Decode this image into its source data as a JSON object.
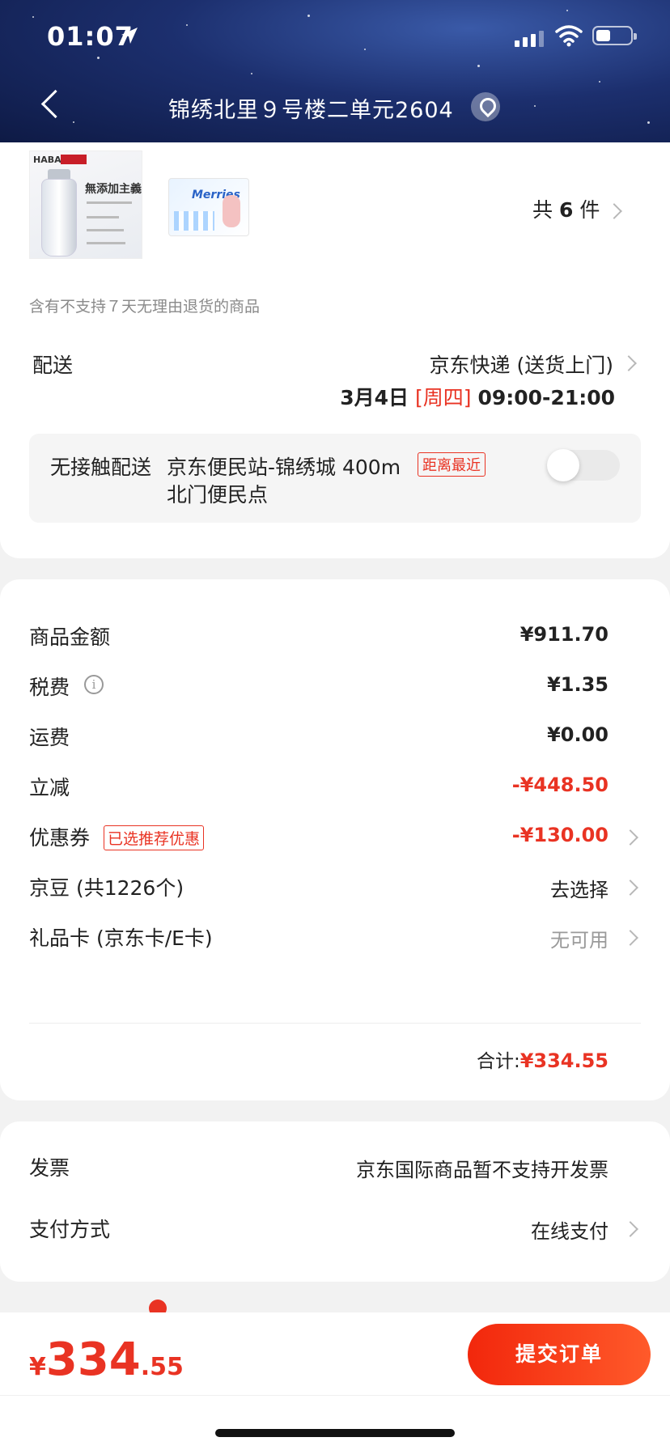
{
  "status_bar": {
    "time": "01:07"
  },
  "header": {
    "address": "锦绣北里９号楼二单元2604"
  },
  "products": {
    "thumb1_brand": "HABA",
    "thumb1_title": "無添加主義",
    "thumb2_logo": "Merries",
    "count_prefix": "共",
    "count_value": "6",
    "count_suffix": "件"
  },
  "return_notice": "含有不支持７天无理由退货的商品",
  "delivery": {
    "label": "配送",
    "method": "京东快递 (送货上门)",
    "date": "3月4日",
    "weekday": "[周四]",
    "time": "09:00-21:00"
  },
  "no_contact": {
    "label": "无接触配送",
    "station": "京东便民站-锦绣城",
    "distance": "400m",
    "point": "北门便民点",
    "badge": "距离最近",
    "enabled": false
  },
  "fees": {
    "goods_label": "商品金额",
    "goods_value": "¥911.70",
    "tax_label": "税费",
    "tax_value": "¥1.35",
    "shipping_label": "运费",
    "shipping_value": "¥0.00",
    "discount_label": "立减",
    "discount_value": "-¥448.50",
    "coupon_label": "优惠券",
    "coupon_badge": "已选推荐优惠",
    "coupon_value": "-¥130.00",
    "beans_label": "京豆 (共1226个)",
    "beans_value": "去选择",
    "giftcard_label": "礼品卡 (京东卡/E卡)",
    "giftcard_value": "无可用",
    "total_label": "合计:",
    "total_value": "¥334.55"
  },
  "invoice": {
    "label": "发票",
    "value": "京东国际商品暂不支持开发票"
  },
  "payment": {
    "label": "支付方式",
    "value": "在线支付"
  },
  "bottom": {
    "price_currency": "¥",
    "price_int": "334",
    "price_dec": ".55",
    "submit_label": "提交订单"
  },
  "colors": {
    "accent": "#e93323",
    "button": "#f2270c",
    "header_bg": "#1c2f6e"
  }
}
